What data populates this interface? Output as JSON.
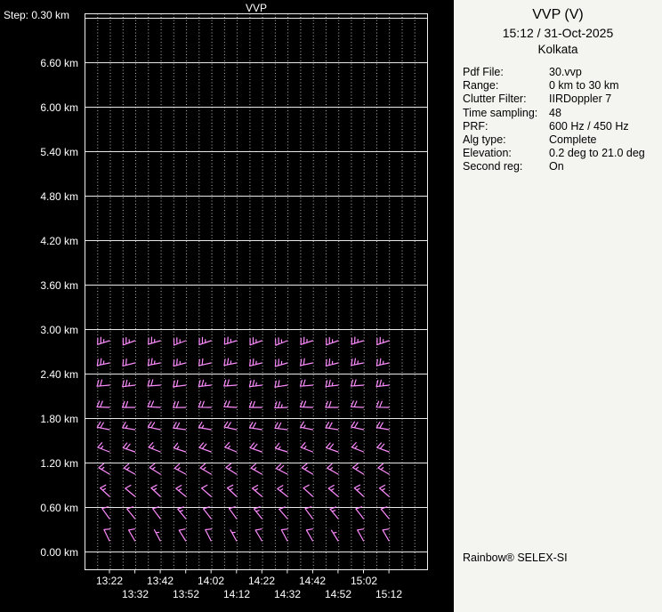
{
  "window": {
    "chart_bg": "#000000",
    "panel_bg": "#f4f4f1",
    "chart_text_color": "#ffffff",
    "barb_color": "#ff8cff",
    "grid_solid_color": "#e8e8e8",
    "grid_dotted_color": "#b5b5b5"
  },
  "chart": {
    "title": "VVP",
    "step_label": "Step: 0.30 km"
  },
  "panel": {
    "title": "VVP (V)",
    "datetime": "15:12 / 31-Oct-2025",
    "location": "Kolkata",
    "fields": [
      {
        "label": "Pdf File:",
        "value": "30.vvp"
      },
      {
        "label": "Range:",
        "value": "0 km to 30 km"
      },
      {
        "label": "Clutter Filter:",
        "value": "IIRDoppler 7"
      },
      {
        "label": "Time sampling:",
        "value": "48"
      },
      {
        "label": "PRF:",
        "value": "600 Hz / 450 Hz"
      },
      {
        "label": "Alg type:",
        "value": "Complete"
      },
      {
        "label": "Elevation:",
        "value": "0.2 deg to 21.0 deg"
      },
      {
        "label": "Second reg:",
        "value": "On"
      }
    ],
    "footer": "Rainbow® SELEX-SI"
  },
  "chart_data": {
    "type": "wind-barb-profile",
    "title": "VVP",
    "x_tick_labels": [
      "13:22",
      "13:32",
      "13:42",
      "13:52",
      "14:02",
      "14:12",
      "14:22",
      "14:32",
      "14:42",
      "14:52",
      "15:02",
      "15:12"
    ],
    "y_tick_labels": [
      "0.00 km",
      "0.60 km",
      "1.20 km",
      "1.80 km",
      "2.40 km",
      "3.00 km",
      "3.60 km",
      "4.20 km",
      "4.80 km",
      "5.40 km",
      "6.00 km",
      "6.60 km"
    ],
    "y_tick_values_km": [
      0.0,
      0.6,
      1.2,
      1.8,
      2.4,
      3.0,
      3.6,
      4.2,
      4.8,
      5.4,
      6.0,
      6.6
    ],
    "height_step_km": 0.3,
    "ylim_km": [
      -0.25,
      7.25
    ],
    "grid": {
      "horizontal": "solid",
      "vertical": "dotted"
    },
    "units": {
      "speed": "kt",
      "height": "km",
      "time": "HH:MM"
    },
    "barb_rows": [
      {
        "height_km": 0.15,
        "dir_deg": [
          334,
          330,
          332,
          328,
          333,
          331,
          329,
          332,
          330,
          328,
          331,
          330
        ],
        "speed_kt": [
          10,
          10,
          5,
          10,
          10,
          5,
          10,
          10,
          10,
          5,
          10,
          10
        ]
      },
      {
        "height_km": 0.45,
        "dir_deg": [
          324,
          321,
          323,
          320,
          322,
          324,
          321,
          319,
          323,
          320,
          322,
          321
        ],
        "speed_kt": [
          10,
          10,
          10,
          15,
          10,
          10,
          15,
          10,
          10,
          15,
          10,
          10
        ]
      },
      {
        "height_km": 0.75,
        "dir_deg": [
          312,
          310,
          313,
          309,
          311,
          313,
          310,
          308,
          312,
          310,
          313,
          311
        ],
        "speed_kt": [
          15,
          10,
          15,
          15,
          10,
          15,
          15,
          15,
          10,
          15,
          15,
          15
        ]
      },
      {
        "height_km": 1.05,
        "dir_deg": [
          301,
          299,
          302,
          298,
          300,
          302,
          299,
          297,
          301,
          299,
          302,
          300
        ],
        "speed_kt": [
          15,
          15,
          15,
          15,
          15,
          15,
          15,
          20,
          15,
          15,
          15,
          15
        ]
      },
      {
        "height_km": 1.35,
        "dir_deg": [
          291,
          289,
          292,
          288,
          290,
          292,
          289,
          287,
          291,
          289,
          292,
          290
        ],
        "speed_kt": [
          15,
          20,
          15,
          15,
          20,
          15,
          20,
          15,
          15,
          20,
          15,
          20
        ]
      },
      {
        "height_km": 1.65,
        "dir_deg": [
          281,
          279,
          282,
          278,
          280,
          282,
          279,
          277,
          281,
          279,
          282,
          280
        ],
        "speed_kt": [
          20,
          15,
          20,
          20,
          15,
          20,
          20,
          20,
          15,
          20,
          20,
          20
        ]
      },
      {
        "height_km": 1.95,
        "dir_deg": [
          272,
          270,
          273,
          269,
          271,
          273,
          270,
          268,
          272,
          270,
          273,
          271
        ],
        "speed_kt": [
          20,
          20,
          20,
          20,
          20,
          20,
          20,
          25,
          20,
          20,
          20,
          20
        ]
      },
      {
        "height_km": 2.25,
        "dir_deg": [
          265,
          263,
          266,
          262,
          264,
          266,
          263,
          261,
          265,
          263,
          266,
          264
        ],
        "speed_kt": [
          20,
          25,
          20,
          20,
          25,
          20,
          25,
          20,
          20,
          25,
          20,
          25
        ]
      },
      {
        "height_km": 2.55,
        "dir_deg": [
          258,
          256,
          259,
          255,
          257,
          259,
          256,
          254,
          258,
          256,
          259,
          257
        ],
        "speed_kt": [
          25,
          20,
          25,
          25,
          20,
          25,
          25,
          25,
          20,
          25,
          25,
          25
        ]
      },
      {
        "height_km": 2.85,
        "dir_deg": [
          252,
          250,
          253,
          249,
          251,
          253,
          250,
          248,
          252,
          250,
          253,
          251
        ],
        "speed_kt": [
          25,
          25,
          25,
          25,
          25,
          25,
          25,
          25,
          25,
          25,
          25,
          25
        ]
      }
    ]
  }
}
